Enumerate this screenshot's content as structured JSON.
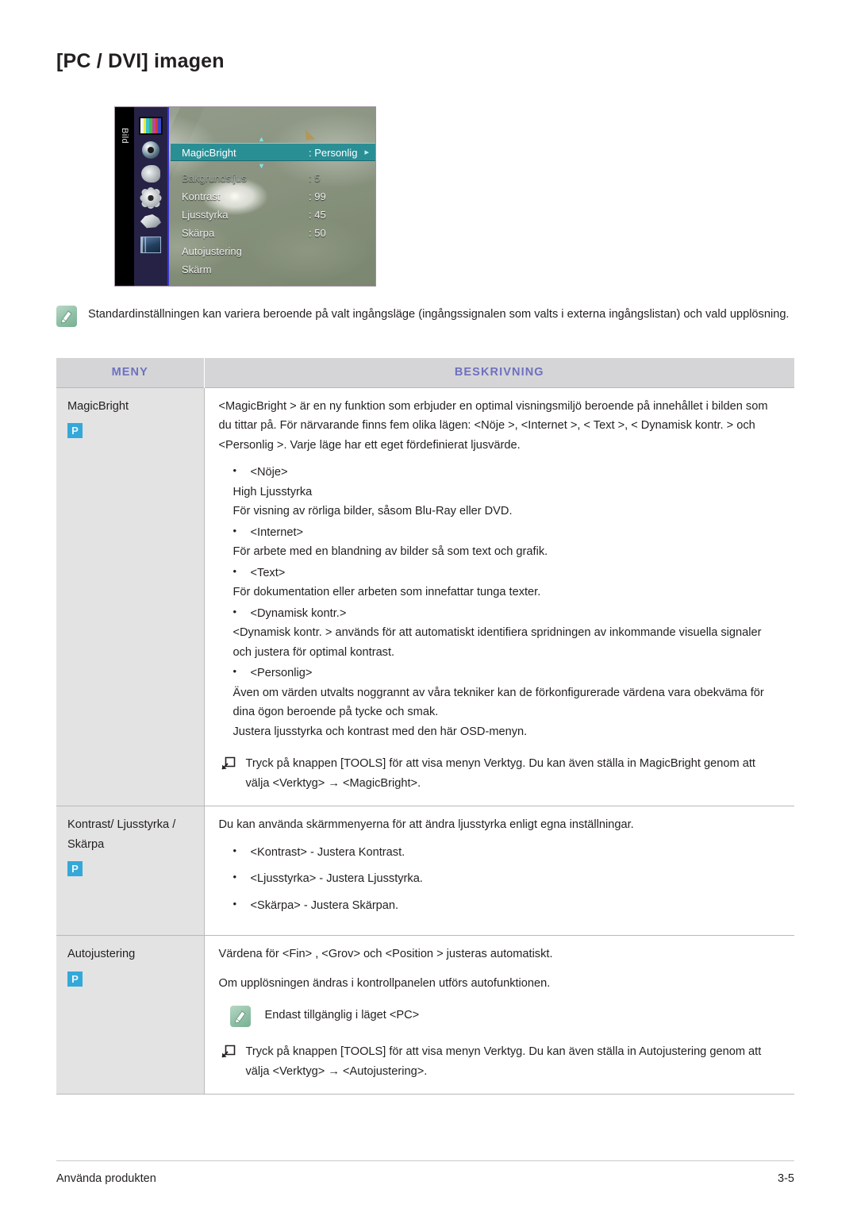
{
  "document": {
    "title": "[PC / DVI] imagen"
  },
  "osd": {
    "sidebar_label": "Bild",
    "icons": [
      "picture-colorbars-icon",
      "sound-icon",
      "audio-speaker-icon",
      "setup-gear-icon",
      "input-plug-icon",
      "multimedia-icon"
    ],
    "rows": [
      {
        "label": "MagicBright",
        "value": ": Personlig",
        "selected": true,
        "dim": false
      },
      {
        "label": "Bakgrundsljus",
        "value": ": 5",
        "selected": false,
        "dim": true
      },
      {
        "label": "Kontrast",
        "value": ": 99",
        "selected": false,
        "dim": false
      },
      {
        "label": "Ljusstyrka",
        "value": ": 45",
        "selected": false,
        "dim": false
      },
      {
        "label": "Skärpa",
        "value": ": 50",
        "selected": false,
        "dim": false
      },
      {
        "label": "Autojustering",
        "value": "",
        "selected": false,
        "dim": false
      },
      {
        "label": "Skärm",
        "value": "",
        "selected": false,
        "dim": false
      }
    ],
    "selected_arrow": "▸",
    "colors": {
      "highlight": "#2a8f95",
      "sidebar": "#262246",
      "rail": "#000000",
      "accent_border": "#3a35d2"
    }
  },
  "note": {
    "icon": "note-pencil-icon",
    "text": "Standardinställningen kan variera beroende på valt ingångsläge (ingångssignalen som valts i externa ingångslistan) och vald upplösning."
  },
  "table": {
    "headers": {
      "menu": "MENY",
      "description": "BESKRIVNING"
    },
    "header_color": "#6f70c0",
    "rows": [
      {
        "menu": "MagicBright",
        "badge": "P",
        "intro": "<MagicBright > är en ny funktion som erbjuder en optimal visningsmiljö beroende på innehållet i bilden som du tittar på. För närvarande finns fem olika lägen: <Nöje >, <Internet >, < Text >, < Dynamisk kontr. > och <Personlig >. Varje läge har ett eget fördefinierat ljusvärde.",
        "bullets": [
          {
            "term": "<Nöje>",
            "lines": [
              "High Ljusstyrka",
              "För visning av rörliga bilder, såsom Blu-Ray eller DVD."
            ]
          },
          {
            "term": "<Internet>",
            "lines": [
              "För arbete med en blandning av bilder så som text och grafik."
            ]
          },
          {
            "term": "<Text>",
            "lines": [
              "För dokumentation eller arbeten som innefattar tunga texter."
            ]
          },
          {
            "term": "<Dynamisk kontr.>",
            "lines": [
              "<Dynamisk kontr. > används för att automatiskt identifiera spridningen av inkommande visuella signaler och justera för optimal kontrast."
            ]
          },
          {
            "term": "<Personlig>",
            "lines": [
              "Även om värden utvalts noggrannt av våra tekniker kan de förkonfigurerade värdena vara obekväma för dina ögon beroende på tycke och smak.",
              "Justera ljusstyrka och kontrast med den här OSD-menyn."
            ]
          }
        ],
        "tools_note": "Tryck på knappen [TOOLS] för att visa menyn Verktyg. Du kan även ställa in MagicBright genom att välja <Verktyg> → <MagicBright>."
      },
      {
        "menu": "Kontrast/ Ljusstyrka / Skärpa",
        "badge": "P",
        "intro": "Du kan använda skärmmenyerna för att ändra ljusstyrka enligt egna inställningar.",
        "bullets": [
          {
            "term": "<Kontrast> - Justera Kontrast.",
            "lines": []
          },
          {
            "term": "<Ljusstyrka> - Justera Ljusstyrka.",
            "lines": []
          },
          {
            "term": "<Skärpa> - Justera Skärpan.",
            "lines": []
          }
        ],
        "tools_note": ""
      },
      {
        "menu": "Autojustering",
        "badge": "P",
        "intro": "Värdena för <Fin> , <Grov> och <Position > justeras automatiskt.",
        "intro2": "Om upplösningen ändras i kontrollpanelen utförs autofunktionen.",
        "inline_note": "Endast tillgänglig i läget <PC>",
        "bullets": [],
        "tools_note": "Tryck på knappen [TOOLS] för att visa menyn Verktyg. Du kan även ställa in Autojustering genom att välja <Verktyg> → <Autojustering>."
      }
    ]
  },
  "footer": {
    "left": "Använda produkten",
    "right": "3-5"
  }
}
